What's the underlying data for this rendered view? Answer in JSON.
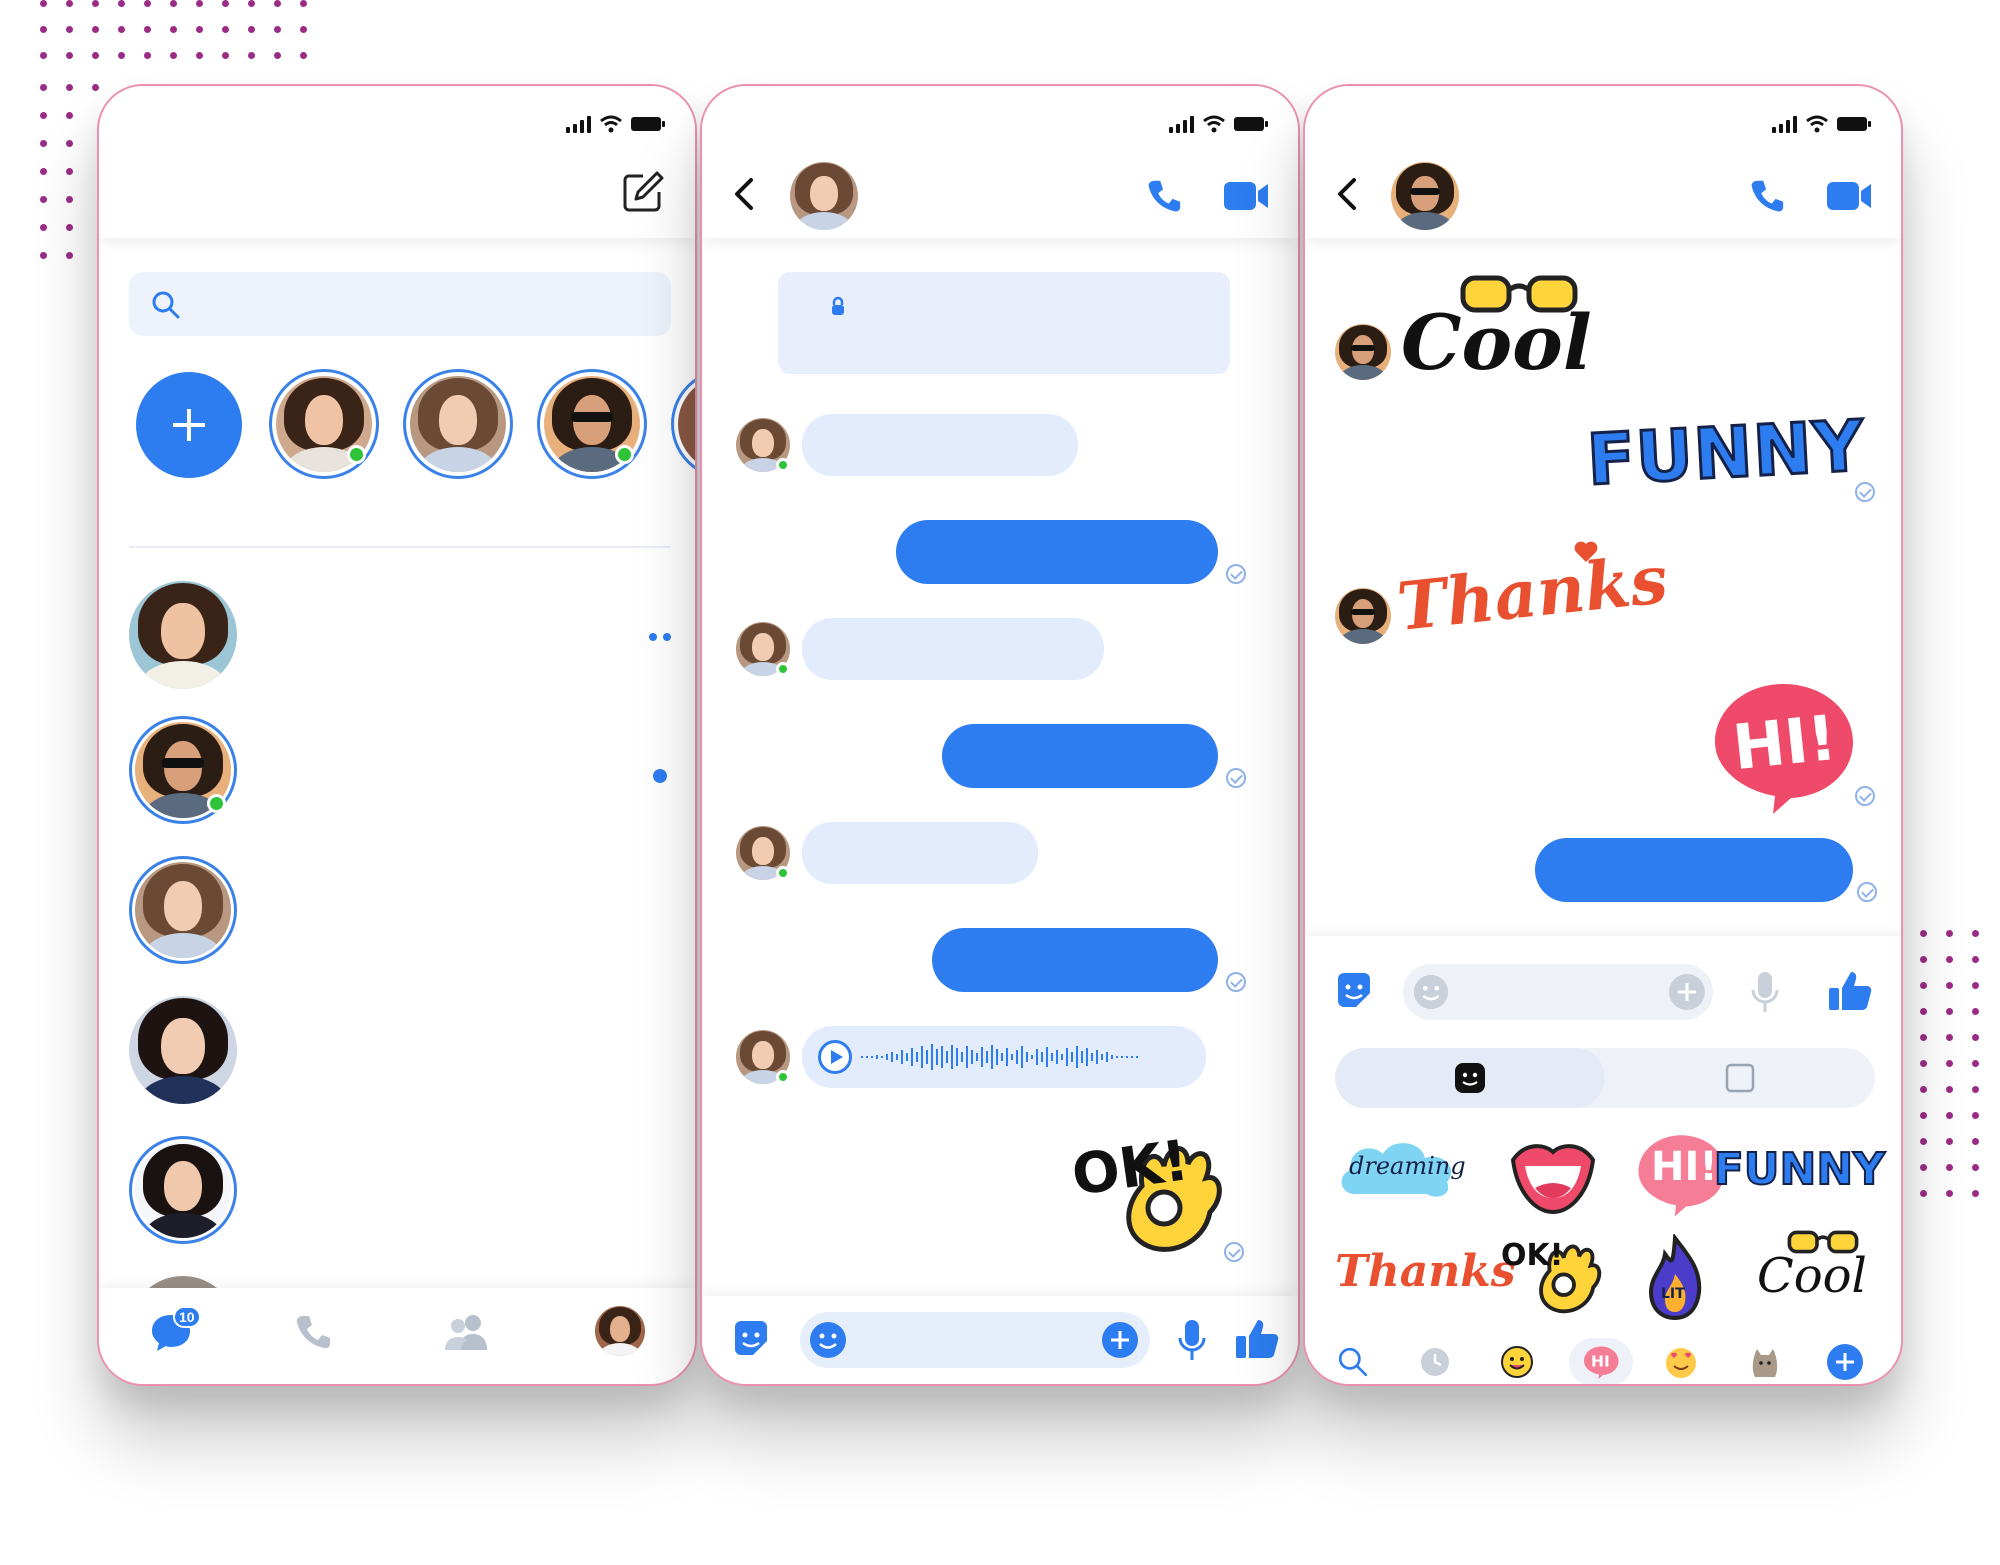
{
  "colors": {
    "accent": "#2d7cf0",
    "incoming_bubble": "#e2ecfc",
    "online": "#2fc339",
    "frame_border": "#ec8fb0",
    "decor_dots": "#9b2c86"
  },
  "inbox": {
    "status_icons": [
      "signal-icon",
      "wifi-icon",
      "battery-icon"
    ],
    "compose_icon": "compose-icon",
    "search_icon": "search-icon",
    "search_placeholder": "",
    "add_story_icon": "plus-icon",
    "chat_list_indicators": [
      "two-dots-unread",
      "one-dot-unread"
    ],
    "tabs": [
      {
        "icon": "chat-bubble-icon",
        "badge": "10"
      },
      {
        "icon": "phone-icon"
      },
      {
        "icon": "people-icon"
      },
      {
        "icon": "profile-avatar"
      }
    ]
  },
  "chat": {
    "header_icons": [
      "back-icon",
      "phone-icon",
      "video-icon"
    ],
    "encryption_icon": "lock-icon",
    "messages": [
      {
        "direction": "in"
      },
      {
        "direction": "out",
        "read": true
      },
      {
        "direction": "in"
      },
      {
        "direction": "out",
        "read": true
      },
      {
        "direction": "in"
      },
      {
        "direction": "out",
        "read": true
      },
      {
        "direction": "in",
        "type": "voice"
      },
      {
        "direction": "out",
        "type": "sticker",
        "sticker": "OK!",
        "read": true
      }
    ],
    "composer_icons": [
      "sticker-icon",
      "emoji-icon",
      "add-icon",
      "mic-icon",
      "thumbs-up-icon"
    ]
  },
  "sticker_chat": {
    "messages": [
      {
        "direction": "in",
        "sticker": "Cool"
      },
      {
        "direction": "out",
        "sticker": "FUNNY"
      },
      {
        "direction": "in",
        "sticker": "Thanks"
      },
      {
        "direction": "out",
        "sticker": "HI!"
      },
      {
        "direction": "out",
        "type": "text"
      }
    ],
    "picker_tabs": [
      "sticker-tab-icon",
      "gif-tab-icon"
    ],
    "stickers": [
      "dreaming",
      "lips",
      "HI!",
      "FUNNY",
      "Thanks",
      "OK!",
      "LIT",
      "Cool"
    ],
    "picker_bar_icons": [
      "search-icon",
      "recent-icon",
      "smile-sticker-pack",
      "hi-sticker-pack",
      "love-sticker-pack",
      "cat-sticker-pack",
      "add-pack-icon"
    ]
  }
}
